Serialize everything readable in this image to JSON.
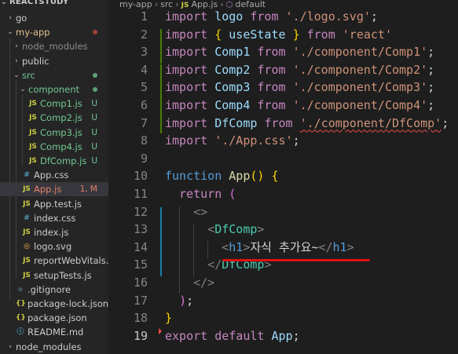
{
  "explorer": {
    "root": "REACTSTUDY",
    "items": [
      {
        "label": "go",
        "chevron": "›",
        "icon": "",
        "badge": "",
        "dot": "",
        "color": "#cccccc"
      },
      {
        "label": "my-app",
        "chevron": "⌄",
        "icon": "",
        "badge": "",
        "dot": "#c74e39",
        "color": "#e2c08d"
      },
      {
        "label": "node_modules",
        "chevron": "›",
        "icon": "",
        "badge": "",
        "dot": "",
        "color": "#8c8c8c"
      },
      {
        "label": "public",
        "chevron": "›",
        "icon": "",
        "badge": "",
        "dot": "",
        "color": "#cccccc"
      },
      {
        "label": "src",
        "chevron": "⌄",
        "icon": "",
        "badge": "",
        "dot": "#73c991",
        "color": "#73c991"
      },
      {
        "label": "component",
        "chevron": "⌄",
        "icon": "",
        "badge": "",
        "dot": "#73c991",
        "color": "#73c991"
      },
      {
        "label": "Comp1.js",
        "chevron": "",
        "icon": "JS",
        "badge": "U",
        "dot": "",
        "color": "#73c991"
      },
      {
        "label": "Comp2.js",
        "chevron": "",
        "icon": "JS",
        "badge": "U",
        "dot": "",
        "color": "#73c991"
      },
      {
        "label": "Comp3.js",
        "chevron": "",
        "icon": "JS",
        "badge": "U",
        "dot": "",
        "color": "#73c991"
      },
      {
        "label": "Comp4.js",
        "chevron": "",
        "icon": "JS",
        "badge": "U",
        "dot": "",
        "color": "#73c991"
      },
      {
        "label": "DfComp.js",
        "chevron": "",
        "icon": "JS",
        "badge": "U",
        "dot": "",
        "color": "#73c991"
      },
      {
        "label": "App.css",
        "chevron": "",
        "icon": "#",
        "badge": "",
        "dot": "",
        "color": "#cccccc"
      },
      {
        "label": "App.js",
        "chevron": "",
        "icon": "JS",
        "badge": "1, M",
        "dot": "",
        "color": "#e2806b"
      },
      {
        "label": "App.test.js",
        "chevron": "",
        "icon": "JS",
        "badge": "",
        "dot": "",
        "color": "#cccccc"
      },
      {
        "label": "index.css",
        "chevron": "",
        "icon": "#",
        "badge": "",
        "dot": "",
        "color": "#cccccc"
      },
      {
        "label": "index.js",
        "chevron": "",
        "icon": "JS",
        "badge": "",
        "dot": "",
        "color": "#cccccc"
      },
      {
        "label": "logo.svg",
        "chevron": "",
        "icon": "◎",
        "badge": "",
        "dot": "",
        "color": "#cccccc"
      },
      {
        "label": "reportWebVitals.js",
        "chevron": "",
        "icon": "JS",
        "badge": "",
        "dot": "",
        "color": "#cccccc"
      },
      {
        "label": "setupTests.js",
        "chevron": "",
        "icon": "JS",
        "badge": "",
        "dot": "",
        "color": "#cccccc"
      },
      {
        "label": ".gitignore",
        "chevron": "",
        "icon": "◆",
        "badge": "",
        "dot": "",
        "color": "#cccccc"
      },
      {
        "label": "package-lock.json",
        "chevron": "",
        "icon": "{}",
        "badge": "",
        "dot": "",
        "color": "#cccccc"
      },
      {
        "label": "package.json",
        "chevron": "",
        "icon": "{}",
        "badge": "",
        "dot": "",
        "color": "#cccccc"
      },
      {
        "label": "README.md",
        "chevron": "",
        "icon": "ⓘ",
        "badge": "",
        "dot": "",
        "color": "#cccccc"
      },
      {
        "label": "node_modules",
        "chevron": "›",
        "icon": "",
        "badge": "",
        "dot": "",
        "color": "#cccccc"
      }
    ]
  },
  "breadcrumb": {
    "parts": [
      "my-app",
      "src",
      "App.js",
      "default"
    ],
    "sep": "›",
    "js_icon": "JS"
  },
  "editor": {
    "active_line": 19,
    "lines": [
      {
        "n": "1",
        "tokens": [
          [
            "kw",
            "import"
          ],
          [
            "plain",
            " "
          ],
          [
            "id",
            "logo"
          ],
          [
            "plain",
            " "
          ],
          [
            "kw",
            "from"
          ],
          [
            "plain",
            " "
          ],
          [
            "str",
            "'./logo.svg'"
          ],
          [
            "plain",
            ";"
          ]
        ]
      },
      {
        "n": "2",
        "tokens": [
          [
            "kw",
            "import"
          ],
          [
            "plain",
            " "
          ],
          [
            "brace1",
            "{"
          ],
          [
            "plain",
            " "
          ],
          [
            "id",
            "useState"
          ],
          [
            "plain",
            " "
          ],
          [
            "brace1",
            "}"
          ],
          [
            "plain",
            " "
          ],
          [
            "kw",
            "from"
          ],
          [
            "plain",
            " "
          ],
          [
            "str",
            "'react'"
          ]
        ]
      },
      {
        "n": "3",
        "tokens": [
          [
            "kw",
            "import"
          ],
          [
            "plain",
            " "
          ],
          [
            "id",
            "Comp1"
          ],
          [
            "plain",
            " "
          ],
          [
            "kw",
            "from"
          ],
          [
            "plain",
            " "
          ],
          [
            "str",
            "'./component/Comp1'"
          ],
          [
            "plain",
            ";"
          ]
        ]
      },
      {
        "n": "4",
        "tokens": [
          [
            "kw",
            "import"
          ],
          [
            "plain",
            " "
          ],
          [
            "id",
            "Comp2"
          ],
          [
            "plain",
            " "
          ],
          [
            "kw",
            "from"
          ],
          [
            "plain",
            " "
          ],
          [
            "str",
            "'./component/Comp2'"
          ],
          [
            "plain",
            ";"
          ]
        ]
      },
      {
        "n": "5",
        "tokens": [
          [
            "kw",
            "import"
          ],
          [
            "plain",
            " "
          ],
          [
            "id",
            "Comp3"
          ],
          [
            "plain",
            " "
          ],
          [
            "kw",
            "from"
          ],
          [
            "plain",
            " "
          ],
          [
            "str",
            "'./component/Comp3'"
          ],
          [
            "plain",
            ";"
          ]
        ]
      },
      {
        "n": "6",
        "tokens": [
          [
            "kw",
            "import"
          ],
          [
            "plain",
            " "
          ],
          [
            "id",
            "Comp4"
          ],
          [
            "plain",
            " "
          ],
          [
            "kw",
            "from"
          ],
          [
            "plain",
            " "
          ],
          [
            "str",
            "'./component/Comp4'"
          ],
          [
            "plain",
            ";"
          ]
        ]
      },
      {
        "n": "7",
        "tokens": [
          [
            "kw",
            "import"
          ],
          [
            "plain",
            " "
          ],
          [
            "id",
            "DfComp"
          ],
          [
            "plain",
            " "
          ],
          [
            "kw",
            "from"
          ],
          [
            "plain",
            " "
          ],
          [
            "str squiggle",
            "'./component/DfComp'"
          ],
          [
            "plain",
            ";"
          ]
        ]
      },
      {
        "n": "8",
        "tokens": [
          [
            "kw",
            "import"
          ],
          [
            "plain",
            " "
          ],
          [
            "str",
            "'./App.css'"
          ],
          [
            "plain",
            ";"
          ]
        ]
      },
      {
        "n": "9",
        "tokens": []
      },
      {
        "n": "10",
        "tokens": [
          [
            "fn-kw",
            "function"
          ],
          [
            "plain",
            " "
          ],
          [
            "fn",
            "App"
          ],
          [
            "brace1",
            "()"
          ],
          [
            "plain",
            " "
          ],
          [
            "brace1",
            "{"
          ]
        ]
      },
      {
        "n": "11",
        "tokens": [
          [
            "plain",
            "  "
          ],
          [
            "kw",
            "return"
          ],
          [
            "plain",
            " "
          ],
          [
            "brace2",
            "("
          ]
        ]
      },
      {
        "n": "12",
        "tokens": [
          [
            "plain",
            "    "
          ],
          [
            "punct",
            "<>"
          ]
        ]
      },
      {
        "n": "13",
        "tokens": [
          [
            "plain",
            "      "
          ],
          [
            "punct",
            "<"
          ],
          [
            "tag",
            "DfComp"
          ],
          [
            "punct",
            ">"
          ]
        ]
      },
      {
        "n": "14",
        "tokens": [
          [
            "plain",
            "        "
          ],
          [
            "punct",
            "<"
          ],
          [
            "html-tag",
            "h1"
          ],
          [
            "punct",
            ">"
          ],
          [
            "plain",
            "자식 추가요~"
          ],
          [
            "punct",
            "</"
          ],
          [
            "html-tag",
            "h1"
          ],
          [
            "punct",
            ">"
          ]
        ]
      },
      {
        "n": "15",
        "tokens": [
          [
            "plain",
            "      "
          ],
          [
            "punct",
            "</"
          ],
          [
            "tag",
            "DfComp"
          ],
          [
            "punct",
            ">"
          ]
        ]
      },
      {
        "n": "16",
        "tokens": [
          [
            "plain",
            "    "
          ],
          [
            "punct",
            "</>"
          ]
        ]
      },
      {
        "n": "17",
        "tokens": [
          [
            "plain",
            "  "
          ],
          [
            "brace2",
            ")"
          ],
          [
            "plain",
            ";"
          ]
        ]
      },
      {
        "n": "18",
        "tokens": [
          [
            "brace1",
            "}"
          ]
        ]
      },
      {
        "n": "19",
        "tokens": [
          [
            "kw",
            "export"
          ],
          [
            "plain",
            " "
          ],
          [
            "kw",
            "default"
          ],
          [
            "plain",
            " "
          ],
          [
            "id",
            "App"
          ],
          [
            "plain",
            ";"
          ]
        ]
      }
    ]
  }
}
